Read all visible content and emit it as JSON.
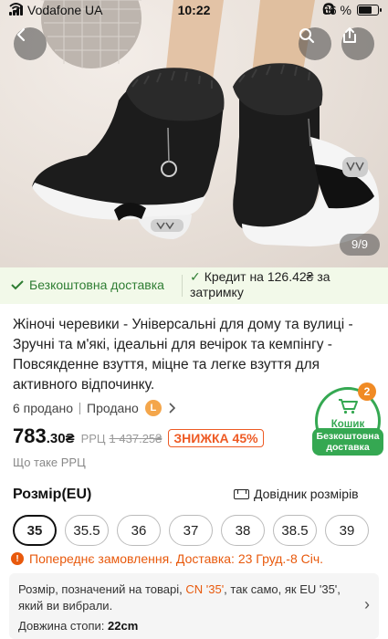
{
  "status_bar": {
    "carrier": "Vodafone UA",
    "time": "10:22",
    "battery": "66 %"
  },
  "gallery": {
    "counter": "9/9"
  },
  "delivery_strip": {
    "free_shipping": "Безкоштовна доставка",
    "credit": "Кредит на 126.42₴ за затримку"
  },
  "product": {
    "title": "Жіночі черевики - Універсальні для дому та вулиці - Зручні та м'які, ідеальні для вечірок та кемпінгу - Повсякденне взуття, міцне та легке взуття для активного відпочинку.",
    "sold": "6 продано",
    "seller_label": "Продано",
    "seller_badge": "L",
    "price_main": "783",
    "price_decimal": ".30₴",
    "rrp_label": "РРЦ",
    "rrp_price": "1 437.25₴",
    "discount": "ЗНИЖКА 45%",
    "rrp_info": "Що таке РРЦ"
  },
  "cart": {
    "label": "Кошик",
    "count": "2",
    "free_delivery": "Безкоштовна доставка"
  },
  "sizes": {
    "heading": "Розмір(EU)",
    "guide": "Довідник розмірів",
    "options": [
      "35",
      "35.5",
      "36",
      "37",
      "38",
      "38.5",
      "39"
    ],
    "selected": "35"
  },
  "preorder": {
    "text": "Попереднє замовлення. Доставка: 23 Груд.-8 Січ."
  },
  "size_note": {
    "text_before": "Розмір, позначений на товарі,",
    "cn_size": "CN '35'",
    "text_after": ", так само, як EU '35', який ви вибрали.",
    "foot_label": "Довжина стопи:",
    "foot_value": "22cm"
  },
  "colors": {
    "accent_green": "#35a852",
    "discount_orange": "#ee5a24",
    "preorder_orange": "#e8590c"
  },
  "icons": [
    "back-arrow-icon",
    "search-icon",
    "share-icon",
    "check-icon",
    "cart-icon",
    "ruler-icon",
    "clock-icon",
    "chevron-right-icon"
  ]
}
